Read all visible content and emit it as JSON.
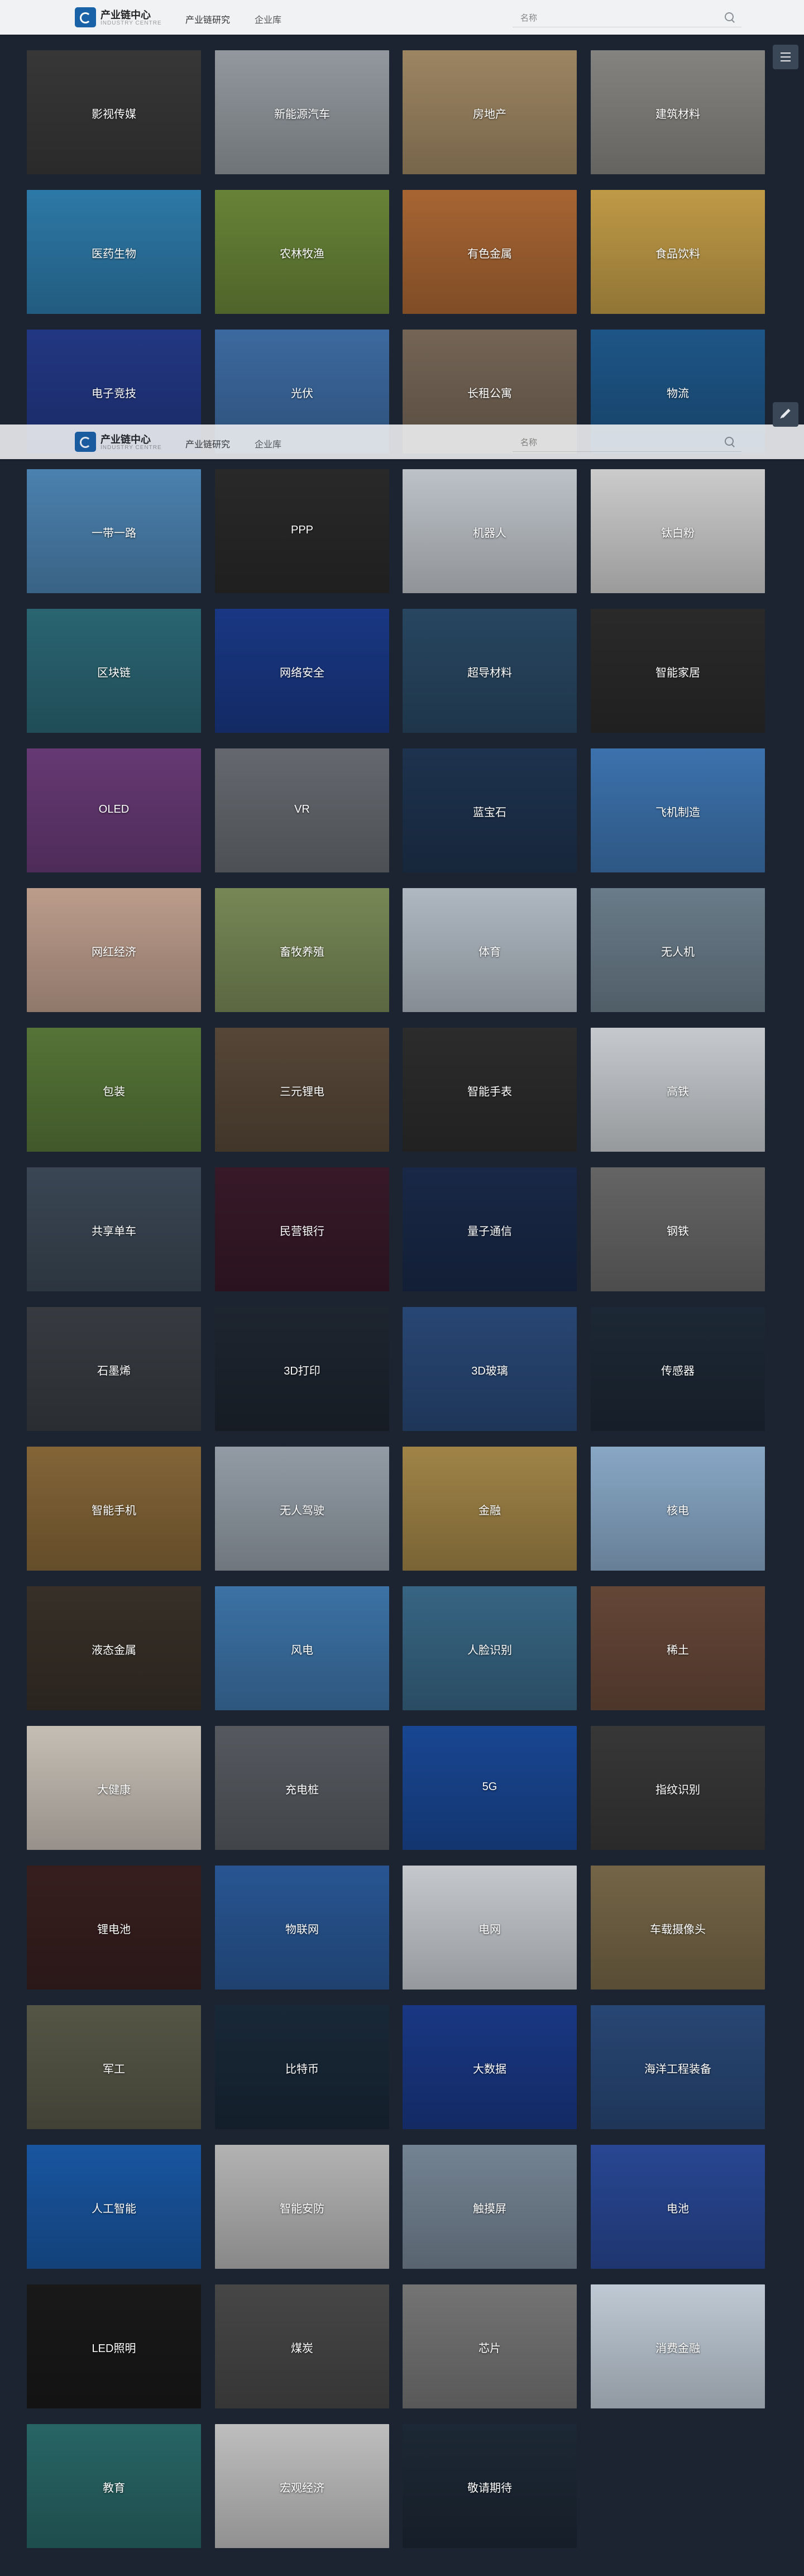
{
  "header": {
    "logo_title": "产业链中心",
    "logo_subtitle": "INDUSTRY CENTRE",
    "nav": [
      {
        "label": "产业链研究"
      },
      {
        "label": "企业库"
      }
    ],
    "search_placeholder": "名称"
  },
  "industries": [
    {
      "label": "影视传媒",
      "bg": "#3a3a3a"
    },
    {
      "label": "新能源汽车",
      "bg": "#9aa0a6"
    },
    {
      "label": "房地产",
      "bg": "#a58c67"
    },
    {
      "label": "建筑材料",
      "bg": "#8c8a86"
    },
    {
      "label": "医药生物",
      "bg": "#2f7fb0"
    },
    {
      "label": "农林牧渔",
      "bg": "#6d8a3a"
    },
    {
      "label": "有色金属",
      "bg": "#b06a35"
    },
    {
      "label": "食品饮料",
      "bg": "#c9a24a"
    },
    {
      "label": "电子竞技",
      "bg": "#243a8a"
    },
    {
      "label": "光伏",
      "bg": "#3f6fa8"
    },
    {
      "label": "长租公寓",
      "bg": "#7a6a5a"
    },
    {
      "label": "物流",
      "bg": "#1f5a8e"
    },
    {
      "label": "一带一路",
      "bg": "#4f88b8"
    },
    {
      "label": "PPP",
      "bg": "#2b2b2b"
    },
    {
      "label": "机器人",
      "bg": "#c7ccd2"
    },
    {
      "label": "钛白粉",
      "bg": "#d6d6d6"
    },
    {
      "label": "区块链",
      "bg": "#2c6a78"
    },
    {
      "label": "网络安全",
      "bg": "#1a3a8a"
    },
    {
      "label": "超导材料",
      "bg": "#2a4a66"
    },
    {
      "label": "智能家居",
      "bg": "#2c2c2c"
    },
    {
      "label": "OLED",
      "bg": "#6b3c7a"
    },
    {
      "label": "VR",
      "bg": "#6a6e74"
    },
    {
      "label": "蓝宝石",
      "bg": "#1f3552"
    },
    {
      "label": "飞机制造",
      "bg": "#3f78b6"
    },
    {
      "label": "网红经济",
      "bg": "#c6a593"
    },
    {
      "label": "畜牧养殖",
      "bg": "#7d8f5a"
    },
    {
      "label": "体育",
      "bg": "#b8c2cc"
    },
    {
      "label": "无人机",
      "bg": "#6f8290"
    },
    {
      "label": "包装",
      "bg": "#5a7a3a"
    },
    {
      "label": "三元锂电",
      "bg": "#5a4a3a"
    },
    {
      "label": "智能手表",
      "bg": "#2e2e2e"
    },
    {
      "label": "高铁",
      "bg": "#d0d4d8"
    },
    {
      "label": "共享单车",
      "bg": "#3d4a58"
    },
    {
      "label": "民营银行",
      "bg": "#3a1a2a"
    },
    {
      "label": "量子通信",
      "bg": "#1a2a4a"
    },
    {
      "label": "钢铁",
      "bg": "#6a6a6a"
    },
    {
      "label": "石墨烯",
      "bg": "#3a3e44"
    },
    {
      "label": "3D打印",
      "bg": "#1f2732"
    },
    {
      "label": "3D玻璃",
      "bg": "#2a4a7a"
    },
    {
      "label": "传感器",
      "bg": "#1e2a38"
    },
    {
      "label": "智能手机",
      "bg": "#8a6a3a"
    },
    {
      "label": "无人驾驶",
      "bg": "#9aa4ae"
    },
    {
      "label": "金融",
      "bg": "#a88a4a"
    },
    {
      "label": "核电",
      "bg": "#8fb0d0"
    },
    {
      "label": "液态金属",
      "bg": "#3a322a"
    },
    {
      "label": "风电",
      "bg": "#3f78ae"
    },
    {
      "label": "人脸识别",
      "bg": "#3a6a8a"
    },
    {
      "label": "稀土",
      "bg": "#6a4a3a"
    },
    {
      "label": "大健康",
      "bg": "#cfc8be"
    },
    {
      "label": "充电桩",
      "bg": "#5a5e64"
    },
    {
      "label": "5G",
      "bg": "#1a4a9a"
    },
    {
      "label": "指纹识别",
      "bg": "#3a3a3a"
    },
    {
      "label": "锂电池",
      "bg": "#3a2020"
    },
    {
      "label": "物联网",
      "bg": "#2a5a9a"
    },
    {
      "label": "电网",
      "bg": "#cfd3d8"
    },
    {
      "label": "车载摄像头",
      "bg": "#7a6a4a"
    },
    {
      "label": "军工",
      "bg": "#5a5a4a"
    },
    {
      "label": "比特币",
      "bg": "#1a2a3a"
    },
    {
      "label": "大数据",
      "bg": "#1a3a8a"
    },
    {
      "label": "海洋工程装备",
      "bg": "#2a4a7a"
    },
    {
      "label": "人工智能",
      "bg": "#1a5aa8"
    },
    {
      "label": "智能安防",
      "bg": "#bcbcbc"
    },
    {
      "label": "触摸屏",
      "bg": "#7a8a9a"
    },
    {
      "label": "电池",
      "bg": "#2a4a9a"
    },
    {
      "label": "LED照明",
      "bg": "#1a1a1a"
    },
    {
      "label": "煤炭",
      "bg": "#4a4a4a"
    },
    {
      "label": "芯片",
      "bg": "#7a7a7a"
    },
    {
      "label": "消费金融",
      "bg": "#c8d4e0"
    },
    {
      "label": "教育",
      "bg": "#2a6a6a"
    },
    {
      "label": "宏观经济",
      "bg": "#c8c8c8"
    },
    {
      "label": "敬请期待",
      "bg": "#1e2a38"
    }
  ]
}
